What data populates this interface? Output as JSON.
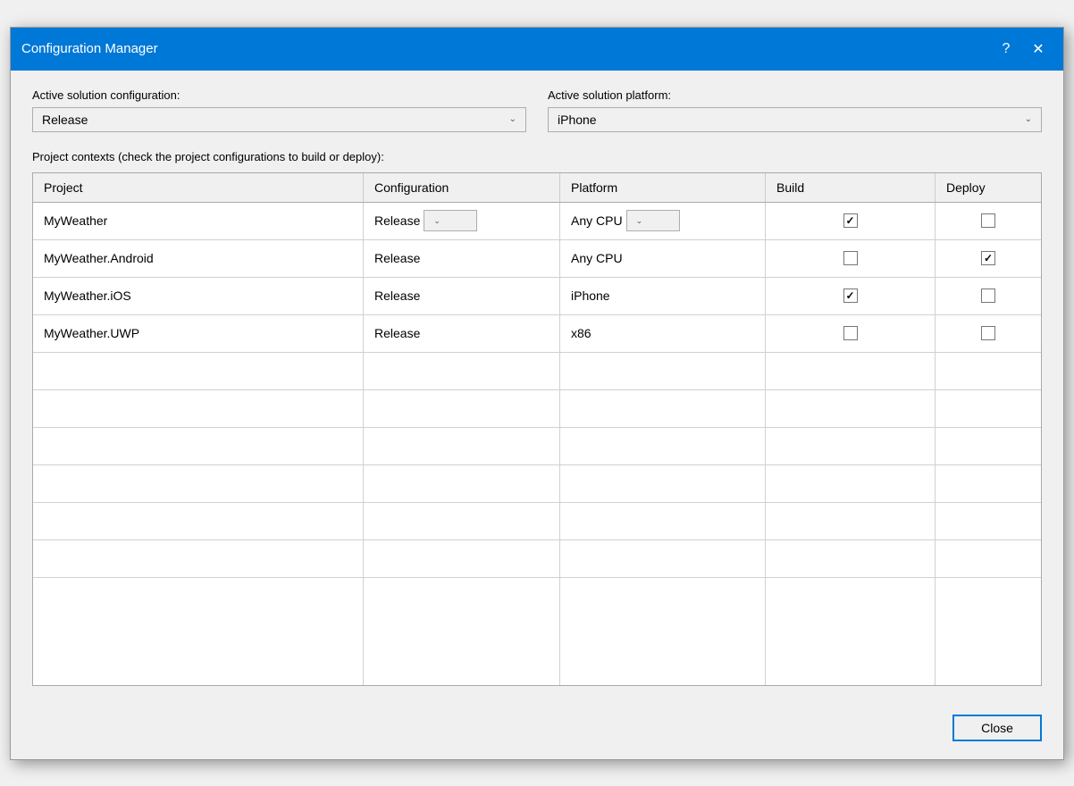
{
  "dialog": {
    "title": "Configuration Manager",
    "help_button": "?",
    "close_button": "✕"
  },
  "active_solution": {
    "config_label": "Active solution configuration:",
    "config_value": "Release",
    "platform_label": "Active solution platform:",
    "platform_value": "iPhone"
  },
  "project_contexts": {
    "label": "Project contexts (check the project configurations to build or deploy):"
  },
  "grid": {
    "headers": [
      "Project",
      "Configuration",
      "Platform",
      "Build",
      "Deploy"
    ],
    "rows": [
      {
        "project": "MyWeather",
        "configuration": "Release",
        "config_has_dropdown": true,
        "platform": "Any CPU",
        "platform_has_dropdown": true,
        "build": true,
        "deploy": false
      },
      {
        "project": "MyWeather.Android",
        "configuration": "Release",
        "config_has_dropdown": false,
        "platform": "Any CPU",
        "platform_has_dropdown": false,
        "build": false,
        "deploy": true
      },
      {
        "project": "MyWeather.iOS",
        "configuration": "Release",
        "config_has_dropdown": false,
        "platform": "iPhone",
        "platform_has_dropdown": false,
        "build": true,
        "deploy": false
      },
      {
        "project": "MyWeather.UWP",
        "configuration": "Release",
        "config_has_dropdown": false,
        "platform": "x86",
        "platform_has_dropdown": false,
        "build": false,
        "deploy": false
      }
    ]
  },
  "footer": {
    "close_label": "Close"
  }
}
